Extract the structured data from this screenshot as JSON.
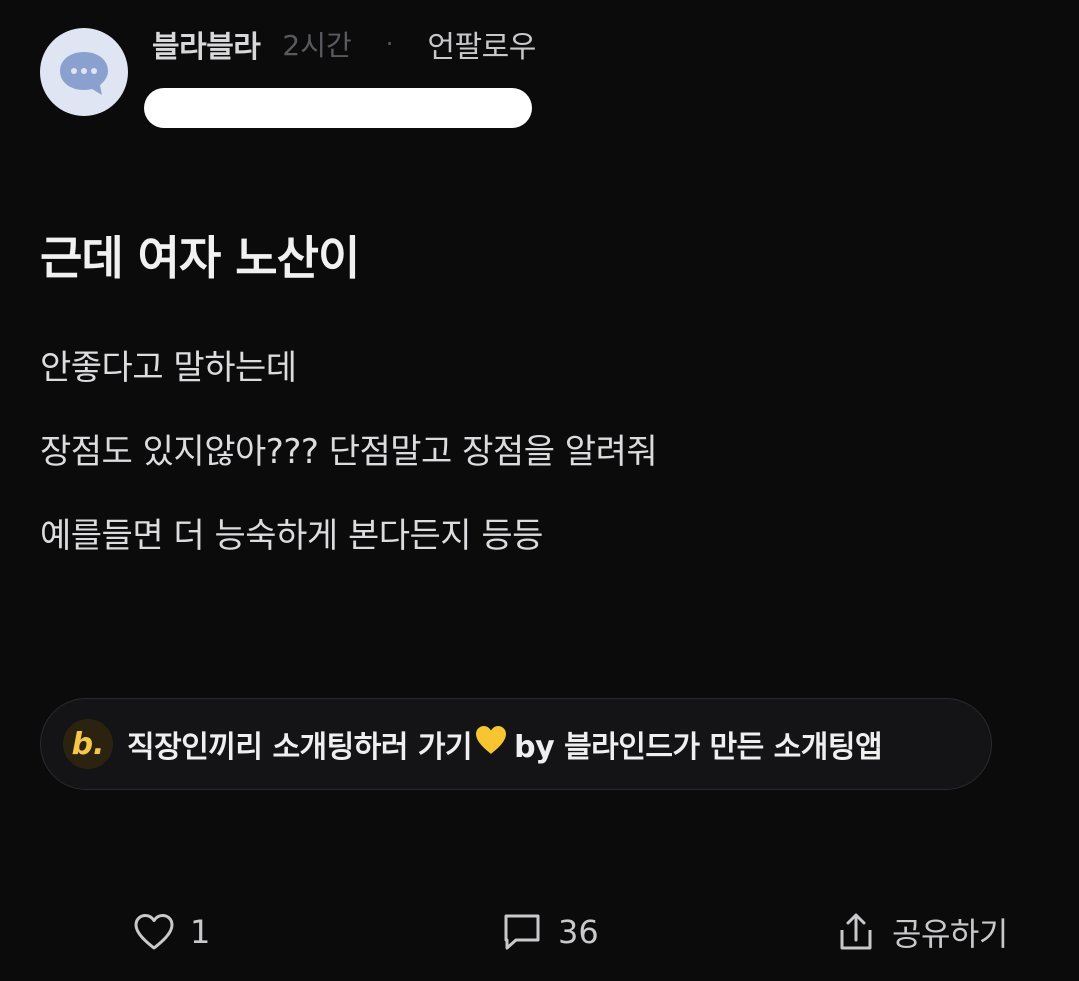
{
  "post": {
    "board_name": "블라블라",
    "timestamp": "2시간",
    "separator": "·",
    "company": "언팔로우",
    "title": "근데 여자 노산이",
    "body_lines": [
      "안좋다고 말하는데",
      "장점도 있지않아??? 단점말고 장점을 알려줘",
      "예를들면 더 능숙하게 본다든지 등등"
    ]
  },
  "promo": {
    "logo_letter": "b.",
    "text_main": "직장인끼리 소개팅하러 가기",
    "text_tail": "by 블라인드가 만든 소개팅앱",
    "icon": "yellow-heart-emoji"
  },
  "actions": {
    "like_count": "1",
    "comment_count": "36",
    "share_label": "공유하기"
  },
  "colors": {
    "background": "#0b0b0c",
    "avatar_bg": "#dfe5f3",
    "avatar_bubble": "#8aa1cf",
    "promo_accent": "#f4c84a"
  }
}
